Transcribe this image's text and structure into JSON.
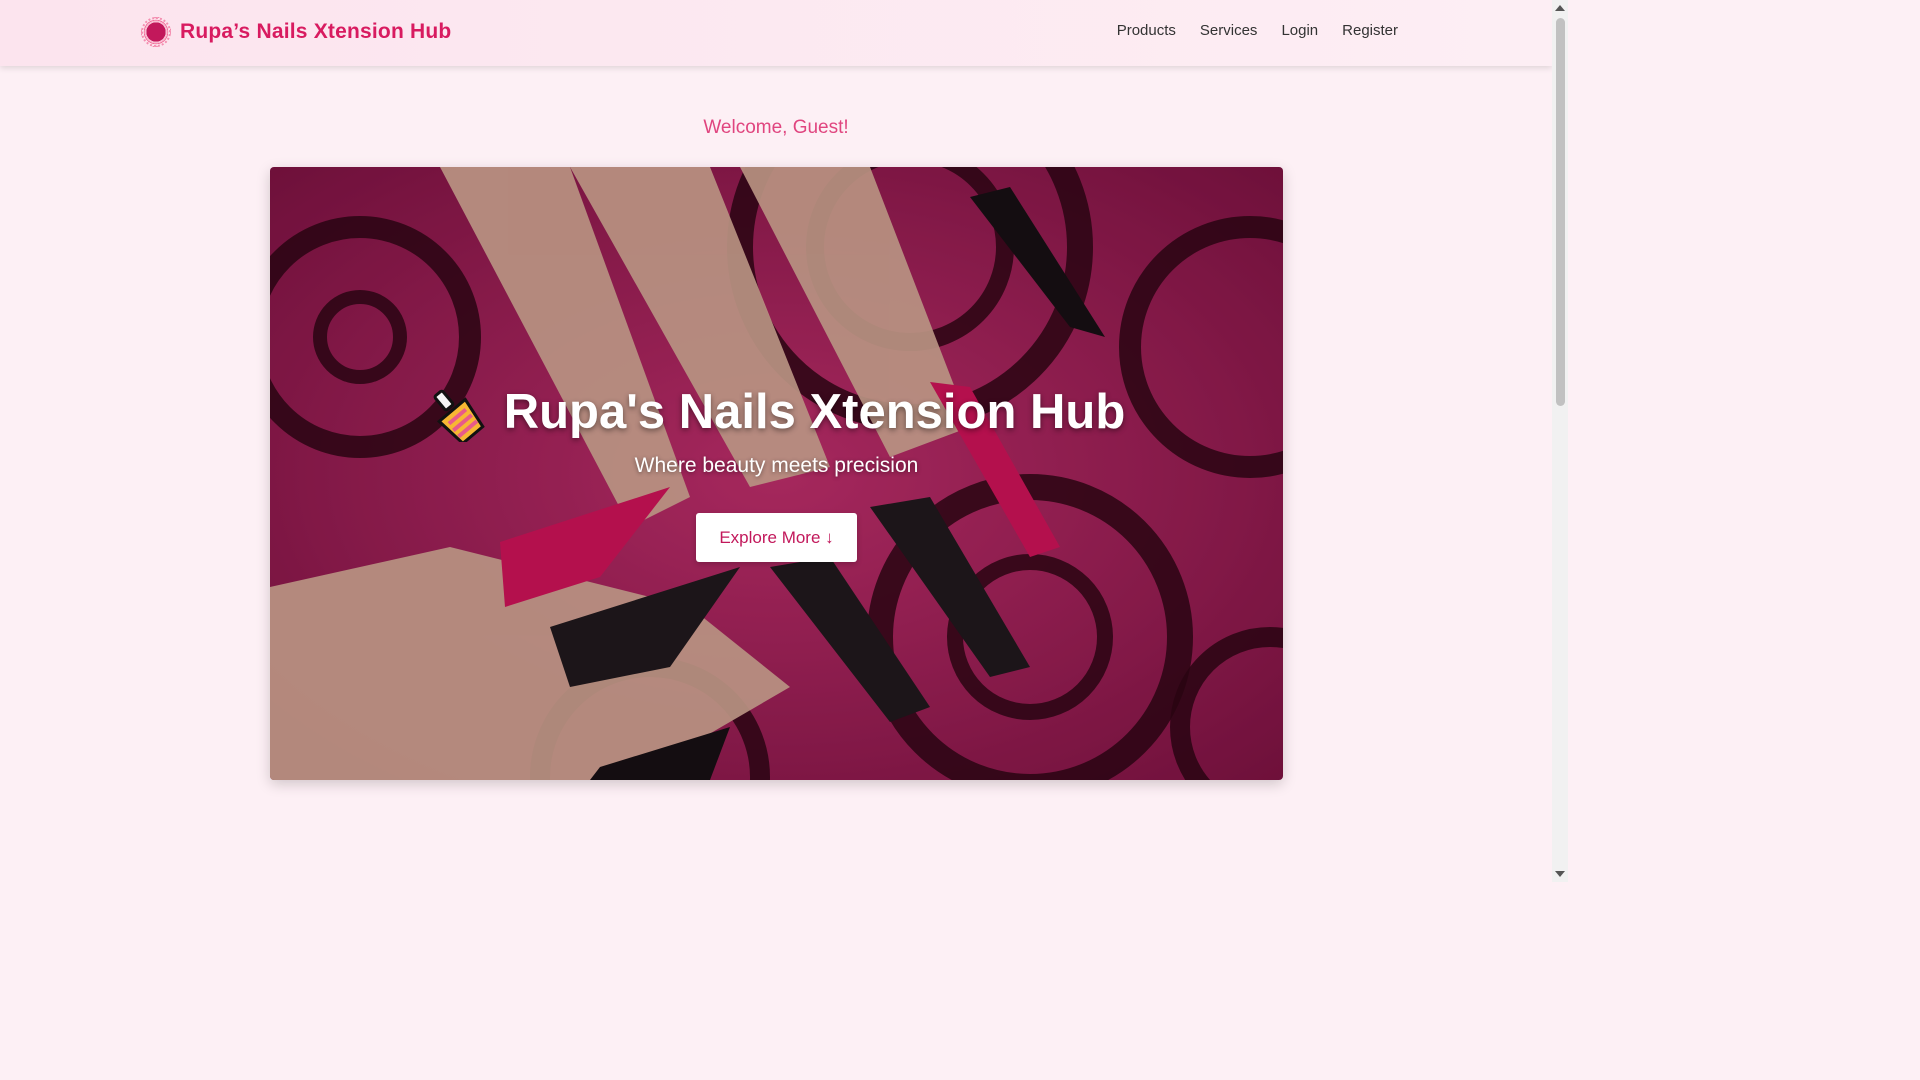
{
  "navbar": {
    "brand": "Rupa’s Nails Xtension Hub",
    "links": [
      "Products",
      "Services",
      "Login",
      "Register"
    ]
  },
  "welcome": "Welcome, Guest!",
  "hero": {
    "title": "Rupa's Nails Xtension Hub",
    "subtitle": "Where beauty meets precision",
    "button": "Explore More ↓",
    "icon": "nail-polish-icon"
  },
  "colors": {
    "accent": "#d81b60",
    "page_bg": "#fdf0f5",
    "welcome": "#e0457f"
  }
}
